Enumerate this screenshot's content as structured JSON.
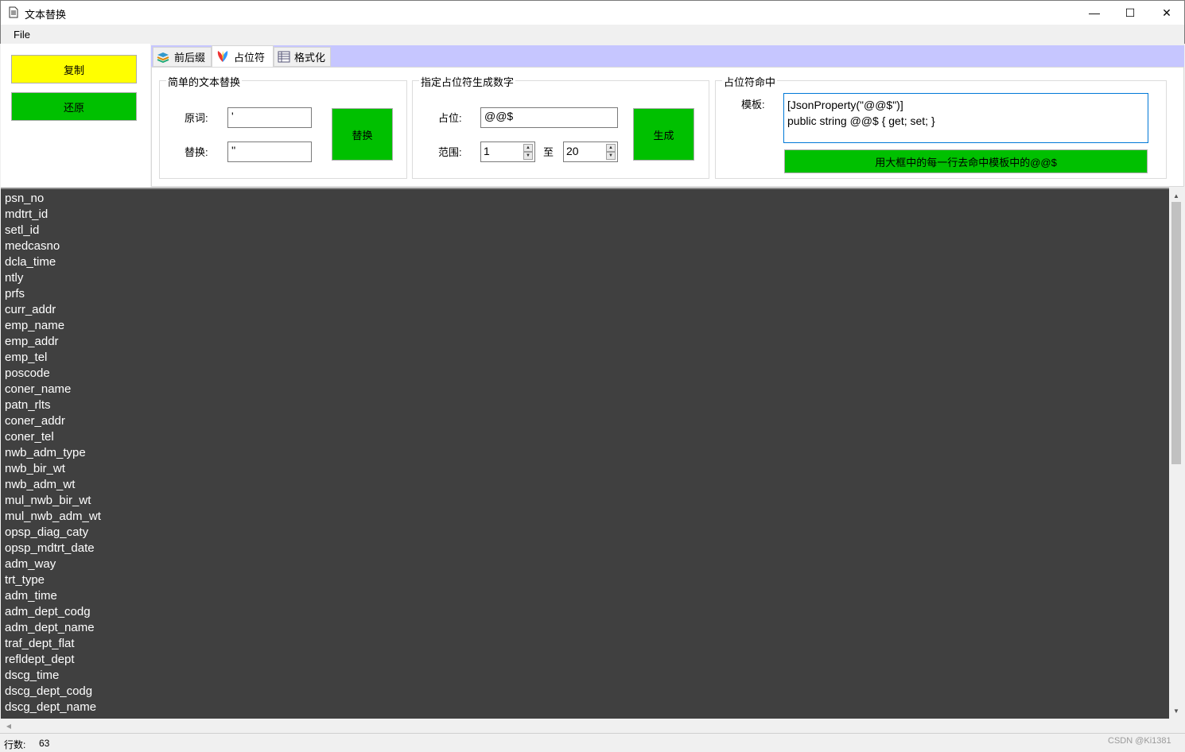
{
  "window": {
    "title": "文本替换",
    "minimize_glyph": "—",
    "maximize_glyph": "☐",
    "close_glyph": "✕"
  },
  "menu": {
    "file": "File"
  },
  "left": {
    "copy_label": "复制",
    "restore_label": "还原"
  },
  "tabs": [
    {
      "label": "前后缀",
      "icon": "stack-icon"
    },
    {
      "label": "占位符",
      "icon": "tulip-icon",
      "active": true
    },
    {
      "label": "格式化",
      "icon": "table-icon"
    }
  ],
  "simple_replace": {
    "title": "简单的文本替换",
    "original_label": "原词:",
    "original_value": "'",
    "replace_label": "替换:",
    "replace_value": "''",
    "button": "替换"
  },
  "placeholder_gen": {
    "title": "指定占位符生成数字",
    "placeholder_label": "占位:",
    "placeholder_value": "@@$",
    "range_label": "范围:",
    "range_from": "1",
    "range_to_label": "至",
    "range_to": "20",
    "button": "生成"
  },
  "placeholder_hit": {
    "title": "占位符命中",
    "template_label": "模板:",
    "template_line1": "[JsonProperty(\"@@$\")]",
    "template_line2": "public string @@$ { get; set; }",
    "button": "用大框中的每一行去命中模板中的@@$"
  },
  "list_items": [
    "psn_no",
    "mdtrt_id",
    "setl_id",
    "medcasno",
    "dcla_time",
    "ntly",
    "prfs",
    "curr_addr",
    "emp_name",
    "emp_addr",
    "emp_tel",
    "poscode",
    "coner_name",
    "patn_rlts",
    "coner_addr",
    "coner_tel",
    "nwb_adm_type",
    "nwb_bir_wt",
    "nwb_adm_wt",
    "mul_nwb_bir_wt",
    "mul_nwb_adm_wt",
    "opsp_diag_caty",
    "opsp_mdtrt_date",
    "adm_way",
    "trt_type",
    "adm_time",
    "adm_dept_codg",
    "adm_dept_name",
    "traf_dept_flat",
    "refldept_dept",
    "dscg_time",
    "dscg_dept_codg",
    "dscg_dept_name"
  ],
  "status": {
    "rows_label": "行数:",
    "rows_value": "63",
    "watermark": "CSDN @Ki1381"
  },
  "colors": {
    "yellow_button": "#ffff00",
    "green_button": "#00c000",
    "tab_strip": "#c6c6ff",
    "list_bg": "#404040"
  }
}
